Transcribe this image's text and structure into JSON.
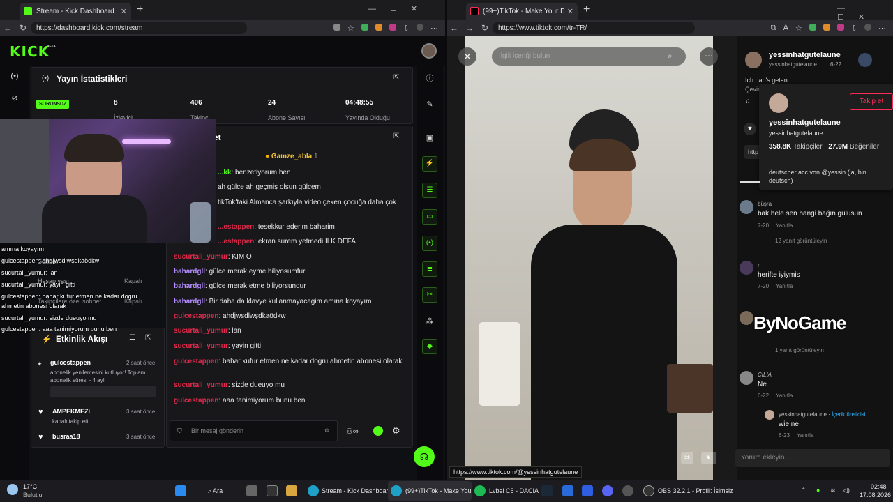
{
  "left_browser": {
    "tab_title": "Stream - Kick Dashboard",
    "url": "https://dashboard.kick.com/stream"
  },
  "kick": {
    "logo": "KICK",
    "beta": "BETA",
    "stats": {
      "title": "Yayın İstatistikleri",
      "status_badge": "SORUNSUZ",
      "items": [
        {
          "value": "8",
          "label": "İzleyici"
        },
        {
          "value": "406",
          "label": "Takipçi"
        },
        {
          "value": "24",
          "label": "Abone Sayısı"
        },
        {
          "value": "04:48:55",
          "label": "Yayında Olduğu"
        }
      ]
    },
    "chat": {
      "title_fragment": "et",
      "pinned_user": "Gamze_abla",
      "pinned_count": "1",
      "messages": [
        {
          "user": "...kk",
          "text": "benzetiyorum ben",
          "cls": "u-green"
        },
        {
          "user": "",
          "text": "ah gülce ah geçmiş olsun gülcem",
          "cls": ""
        },
        {
          "user": "",
          "text": "tikTok'taki Almanca şarkıyla video çeken çocuğa daha çok",
          "cls": ""
        },
        {
          "user": "...estappen",
          "text": "tesekkur ederim baharim",
          "cls": "u-red"
        },
        {
          "user": "...estappen",
          "text": "ekran surem yetmedi ILK DEFA",
          "cls": "u-red"
        },
        {
          "user": "sucurtali_yumur",
          "text": "KIM O",
          "cls": "u-red"
        },
        {
          "user": "bahardgll",
          "text": "gülce merak eyme biliyosumfur",
          "cls": "u-purple"
        },
        {
          "user": "bahardgll",
          "text": "gülce merak etme biliyorsundur",
          "cls": "u-purple"
        },
        {
          "user": "bahardgll",
          "text": "Bir daha da klavye kullanmayacagim amına koyayım",
          "cls": "u-purple"
        },
        {
          "user": "gulcestappen",
          "text": "ahdjwsdlwşdkaödkw",
          "cls": "u-red"
        },
        {
          "user": "sucurtali_yumur",
          "text": "lan",
          "cls": "u-red"
        },
        {
          "user": "sucurtali_yumur",
          "text": "yayin gitti",
          "cls": "u-red"
        },
        {
          "user": "gulcestappen",
          "text": "bahar kufur etmen ne kadar dogru ahmetin abonesi olarak",
          "cls": "u-red"
        },
        {
          "user": "sucurtali_yumur",
          "text": "sizde dueuyo mu",
          "cls": "u-red"
        },
        {
          "user": "gulcestappen",
          "text": "aaa tanimiyorum bunu ben",
          "cls": "u-red"
        }
      ],
      "input_placeholder": "Bir mesaj gönderin"
    },
    "overlay": {
      "lines": [
        "amına koyayım",
        "gulcestappen: ahdjwsdlwşdkaödkw",
        "sucurtali_yumur: lan",
        "sucurtali_yumur: yayin gitti",
        "gulcestappen: bahar kufur etmen ne kadar dogru",
        "ahmetin abonesi olarak",
        "sucurtali_yumur: sizde dueuyo mu",
        "gulcestappen: aaa tanimiyorum bunu ben"
      ],
      "settings_header": "Sohbet",
      "settings": [
        {
          "label": "Hesap yaşı",
          "value": "Kapalı"
        },
        {
          "label": "Takipçilere özel sohbet",
          "value": "Kapalı"
        }
      ]
    },
    "events": {
      "title": "Etkinlik Akışı",
      "items": [
        {
          "name": "gulcestappen",
          "time": "2 saat önce",
          "text": "abonelik yenilemesini kutluyor! Toplam abonelik süresi - 4 ay!"
        },
        {
          "name": "AMPEKMEZi",
          "time": "3 saat önce",
          "text": "kanalı takip etti"
        },
        {
          "name": "busraa18",
          "time": "3 saat önce",
          "text": ""
        }
      ]
    }
  },
  "right_browser": {
    "tab_title": "(99+)TikTok - Make Your Day",
    "url": "https://www.tiktok.com/tr-TR/"
  },
  "tiktok": {
    "search_placeholder": "İlgili içeriği bulun",
    "author": "yessinhatgutelaune",
    "author_sub": "yessinhatgutelaune",
    "date": "6-22",
    "caption": "Ich hab's getan",
    "caption_sub": "Çevir",
    "popup": {
      "name": "yessinhatgutelaune",
      "handle": "yessinhatgutelaune",
      "follow": "Takip et",
      "followers_count": "358.8K",
      "followers_label": "Takipçiler",
      "likes_count": "27.9M",
      "likes_label": "Beğeniler",
      "bio": "deutscher acc von @yessin (ja, bin deutsch)"
    },
    "link_fragment": "http",
    "comments": [
      {
        "user": "büşra",
        "text": "bak hele sen hangi bağın gülüsün",
        "meta": "7-20",
        "reply": "Yanıtla",
        "more": "12 yanıt görüntüleyin"
      },
      {
        "user": "n",
        "text": "herifte iyiymis",
        "meta": "7-20",
        "reply": "Yanıtla",
        "more": ""
      },
      {
        "user": "",
        "text": "",
        "meta": "",
        "reply": "",
        "more": "1 yanıt görüntüleyin"
      },
      {
        "user": "CILIA",
        "text": "Ne",
        "meta": "6-22",
        "reply": "Yanıtla",
        "more": ""
      }
    ],
    "creator_reply": {
      "user": "yessinhatgutelaune",
      "badge": "İçerik üreticisi",
      "text": "wie ne",
      "meta": "6-23",
      "reply": "Yanıtla"
    },
    "comment_placeholder": "Yorum ekleyin...",
    "watermark": "ByNoGame",
    "status_url": "https://www.tiktok.com/@yessinhatgutelaune"
  },
  "taskbar": {
    "weather_temp": "17°C",
    "weather_desc": "Bulutlu",
    "search": "Ara",
    "apps": [
      {
        "label": "Stream - Kick Dashboard"
      },
      {
        "label": "(99+)TikTok - Make You"
      },
      {
        "label": "Lvbel C5 - DACIA"
      },
      {
        "label": "OBS 32.2.1 - Profil: İsimsiz"
      }
    ],
    "time": "02:48",
    "date": "17.08.2026"
  },
  "colors": {
    "kick_green": "#53fc18",
    "tiktok_red": "#fe2c55"
  }
}
